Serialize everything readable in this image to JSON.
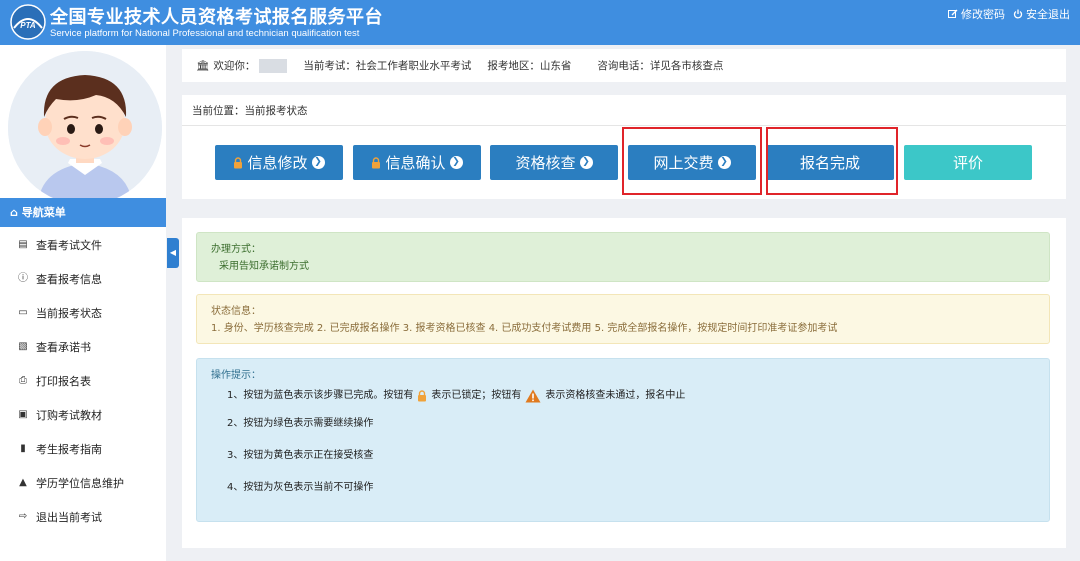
{
  "header": {
    "title": "全国专业技术人员资格考试报名服务平台",
    "subtitle": "Service platform for National Professional and technician qualification test",
    "logo_text": "PTA",
    "change_password": "修改密码",
    "logout": "安全退出"
  },
  "sidebar": {
    "nav_title": "导航菜单",
    "items": [
      {
        "label": "查看考试文件",
        "icon": "document-icon"
      },
      {
        "label": "查看报考信息",
        "icon": "info-icon"
      },
      {
        "label": "当前报考状态",
        "icon": "monitor-icon"
      },
      {
        "label": "查看承诺书",
        "icon": "id-card-icon"
      },
      {
        "label": "打印报名表",
        "icon": "printer-icon"
      },
      {
        "label": "订购考试教材",
        "icon": "cart-icon"
      },
      {
        "label": "考生报考指南",
        "icon": "book-icon"
      },
      {
        "label": "学历学位信息维护",
        "icon": "graduation-cap-icon"
      },
      {
        "label": "退出当前考试",
        "icon": "sign-out-icon"
      }
    ]
  },
  "welcome": {
    "greeting": "欢迎你：",
    "exam": "当前考试：社会工作者职业水平考试",
    "region": "报考地区：山东省",
    "phone": "咨询电话：详见各市核查点"
  },
  "status": {
    "breadcrumb": "当前位置：当前报考状态",
    "steps": [
      {
        "label": "信息修改",
        "locked": true,
        "arrow": true,
        "color": "#2b7ec0"
      },
      {
        "label": "信息确认",
        "locked": true,
        "arrow": true,
        "color": "#2b7ec0"
      },
      {
        "label": "资格核查",
        "locked": false,
        "arrow": true,
        "color": "#2b7ec0"
      },
      {
        "label": "网上交费",
        "locked": false,
        "arrow": true,
        "color": "#2b7ec0"
      },
      {
        "label": "报名完成",
        "locked": false,
        "arrow": false,
        "color": "#2b7ec0"
      },
      {
        "label": "评价",
        "locked": false,
        "arrow": false,
        "color": "#3cc7c8"
      }
    ]
  },
  "info": {
    "method_title": "办理方式：",
    "method_text": "采用告知承诺制方式",
    "state_title": "状态信息：",
    "state_text": "1. 身份、学历核查完成 2. 已完成报名操作 3. 报考资格已核查 4. 已成功支付考试费用 5. 完成全部报名操作，按规定时间打印准考证参加考试",
    "tips_title": "操作提示：",
    "tip1_a": "1、按钮为蓝色表示该步骤已完成。按钮有",
    "tip1_b": "表示已锁定；按钮有",
    "tip1_c": "表示资格核查未通过，报名中止",
    "tip2": "2、按钮为绿色表示需要继续操作",
    "tip3": "3、按钮为黄色表示正在接受核查",
    "tip4": "4、按钮为灰色表示当前不可操作"
  },
  "colors": {
    "brand_blue": "#3f8ee0",
    "button_blue": "#2b7ec0",
    "button_teal": "#3cc7c8",
    "highlight_red": "#e0242a"
  }
}
